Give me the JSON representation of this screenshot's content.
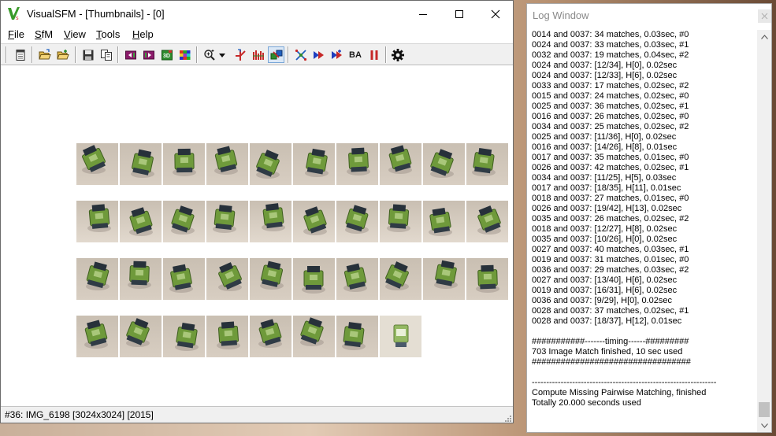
{
  "main_window": {
    "title": "VisualSFM - [Thumbnails] - [0]",
    "menu": [
      {
        "pre": "",
        "key": "F",
        "post": "ile"
      },
      {
        "pre": "",
        "key": "S",
        "post": "fM"
      },
      {
        "pre": "",
        "key": "V",
        "post": "iew"
      },
      {
        "pre": "",
        "key": "T",
        "post": "ools"
      },
      {
        "pre": "",
        "key": "H",
        "post": "elp"
      }
    ],
    "toolbar": {
      "ba_label": "BA",
      "icons": [
        "notepad-icon",
        "open-folder-icon",
        "open-multiple-icon",
        "save-icon",
        "copy-icon",
        "model-prev-icon",
        "model-next-icon",
        "show-3d-icon",
        "color-grid-icon",
        "zoom-icon",
        "dropdown-arrow-icon",
        "feature-tracks-icon",
        "match-matrix-icon",
        "pair-view-icon",
        "compute-matches-icon",
        "sparse-reconstruction-icon",
        "dense-reconstruction-icon",
        "bundle-adjust-icon",
        "pause-icon",
        "settings-gear-icon"
      ]
    },
    "status": "#36: IMG_6198 [3024x3024] [2015]",
    "thumbnail_count": 38
  },
  "log_window": {
    "title": "Log Window",
    "lines": [
      "0014 and 0037: 34 matches, 0.03sec, #0",
      "0024 and 0037: 33 matches, 0.03sec, #1",
      "0032 and 0037: 19 matches, 0.04sec, #2",
      "0024 and 0037: [12/34], H[0], 0.02sec",
      "0024 and 0037: [12/33], H[6], 0.02sec",
      "0033 and 0037: 17 matches, 0.02sec, #2",
      "0015 and 0037: 24 matches, 0.02sec, #0",
      "0025 and 0037: 36 matches, 0.02sec, #1",
      "0016 and 0037: 26 matches, 0.02sec, #0",
      "0034 and 0037: 25 matches, 0.02sec, #2",
      "0025 and 0037: [11/36], H[0], 0.02sec",
      "0016 and 0037: [14/26], H[8], 0.01sec",
      "0017 and 0037: 35 matches, 0.01sec, #0",
      "0026 and 0037: 42 matches, 0.02sec, #1",
      "0034 and 0037: [11/25], H[5], 0.03sec",
      "0017 and 0037: [18/35], H[11], 0.01sec",
      "0018 and 0037: 27 matches, 0.01sec, #0",
      "0026 and 0037: [19/42], H[13], 0.02sec",
      "0035 and 0037: 26 matches, 0.02sec, #2",
      "0018 and 0037: [12/27], H[8], 0.02sec",
      "0035 and 0037: [10/26], H[0], 0.02sec",
      "0027 and 0037: 40 matches, 0.03sec, #1",
      "0019 and 0037: 31 matches, 0.01sec, #0",
      "0036 and 0037: 29 matches, 0.03sec, #2",
      "0027 and 0037: [13/40], H[6], 0.02sec",
      "0019 and 0037: [16/31], H[6], 0.02sec",
      "0036 and 0037: [9/29], H[0], 0.02sec",
      "0028 and 0037: 37 matches, 0.02sec, #1",
      "0028 and 0037: [18/37], H[12], 0.01sec",
      "",
      "###########-------timing------#########",
      "703 Image Match finished, 10 sec used",
      "#################################",
      "",
      "----------------------------------------------------------------",
      "Compute Missing Pairwise Matching, finished",
      "Totally 20.000 seconds used"
    ]
  },
  "colors": {
    "window_bg": "#ffffff",
    "toolbar_bg": "#f0f0f0",
    "log_title": "#8a8a8a",
    "logo_green": "#3a9a2a",
    "robot_green": "#6f9a3b",
    "floor": "#d9cfc4"
  }
}
